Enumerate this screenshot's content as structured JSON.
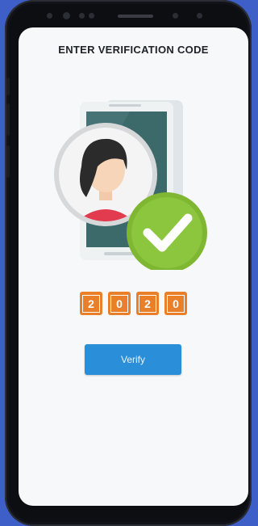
{
  "screen": {
    "title": "ENTER VERIFICATION CODE"
  },
  "illustration": {
    "icon": "verified-user-icon",
    "check_icon": "checkmark-icon"
  },
  "code": {
    "digits": [
      "2",
      "0",
      "2",
      "0"
    ]
  },
  "actions": {
    "verify_label": "Verify"
  },
  "colors": {
    "background": "#3f5fc8",
    "screen": "#f6f8fa",
    "digit_box": "#ea7f2a",
    "button": "#2a8fd8",
    "check_badge": "#8cc63f"
  }
}
